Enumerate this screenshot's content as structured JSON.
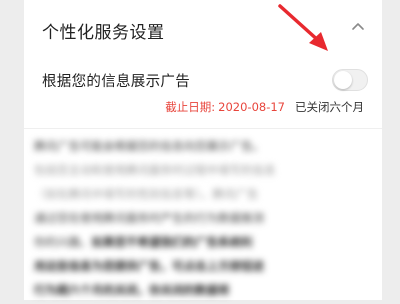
{
  "section": {
    "title": "个性化服务设置",
    "collapse_icon": "chevron-up-icon"
  },
  "setting": {
    "label": "根据您的信息展示广告",
    "toggle_on": false,
    "expiry_label": "截止日期:",
    "expiry_date": "2020-08-17",
    "status": "已关闭六个月"
  },
  "description": {
    "blurred": true
  },
  "colors": {
    "accent_red": "#e8453c",
    "annotation_arrow": "#e8292f"
  }
}
